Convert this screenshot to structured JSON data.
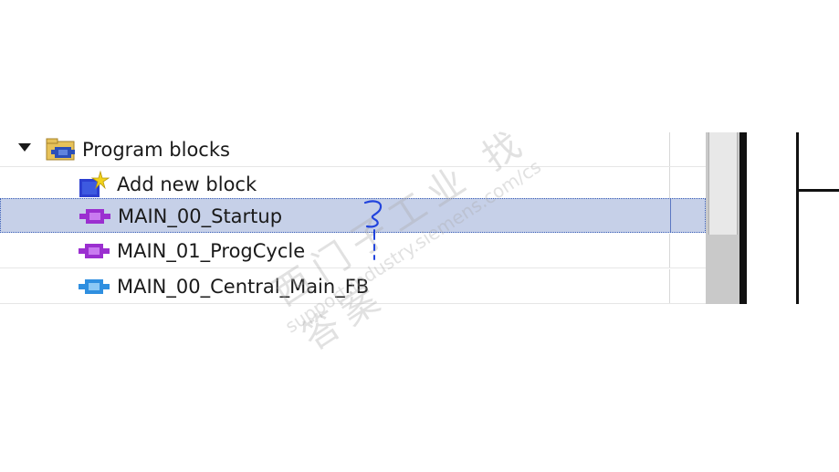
{
  "project_tree": {
    "group": {
      "label": "Program blocks",
      "icon": "program-blocks-folder-icon",
      "expanded": true
    },
    "items": [
      {
        "label": "Add new block",
        "icon": "add-new-block-icon",
        "selected": false
      },
      {
        "label": "MAIN_00_Startup",
        "icon": "ob-block-icon",
        "selected": true
      },
      {
        "label": "MAIN_01_ProgCycle",
        "icon": "ob-block-icon",
        "selected": false
      },
      {
        "label": "MAIN_00_Central_Main_FB",
        "icon": "fb-block-icon",
        "selected": false
      }
    ]
  },
  "watermark": {
    "cn_text": "西门子工业 找答案",
    "en_text": "support.industry.siemens.com/cs"
  },
  "colors": {
    "selection_bg": "#c6d0e8",
    "ob_block": "#9b2fd0",
    "fb_block": "#2f8fe0",
    "add_block_blue": "#2c3fd0",
    "add_block_star": "#f2d21a",
    "annotation_ink": "#2244dd"
  }
}
